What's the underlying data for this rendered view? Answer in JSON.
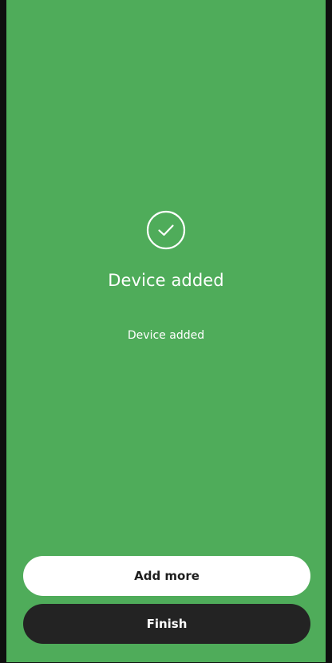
{
  "theme": {
    "background_color": "#4fac5a",
    "frame_color": "#0f0f0f",
    "primary_button_color": "#ffffff",
    "secondary_button_color": "#232323"
  },
  "status": {
    "icon": "check-circle-icon",
    "title": "Device added",
    "message": "Device added"
  },
  "actions": {
    "add_more_label": "Add more",
    "finish_label": "Finish"
  }
}
